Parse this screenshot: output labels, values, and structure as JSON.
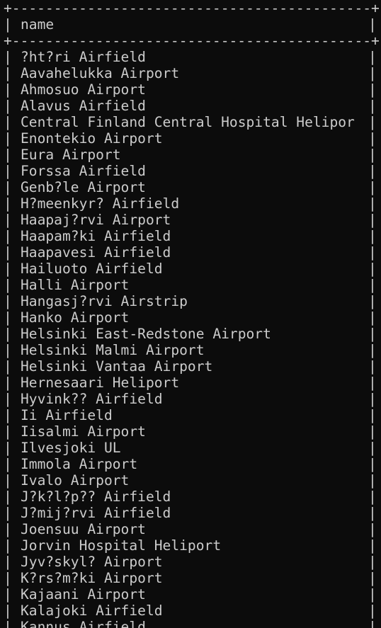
{
  "table": {
    "border_top": "+-------------------------------------------+",
    "header": "name",
    "border_mid": "+-------------------------------------------+",
    "pipe": "|",
    "rows": [
      "?ht?ri Airfield",
      "Aavahelukka Airport",
      "Ahmosuo Airport",
      "Alavus Airfield",
      "Central Finland Central Hospital Helipor",
      "Enontekio Airport",
      "Eura Airport",
      "Forssa Airfield",
      "Genb?le Airport",
      "H?meenkyr? Airfield",
      "Haapaj?rvi Airport",
      "Haapam?ki Airfield",
      "Haapavesi Airfield",
      "Hailuoto Airfield",
      "Halli Airport",
      "Hangasj?rvi Airstrip",
      "Hanko Airport",
      "Helsinki East-Redstone Airport",
      "Helsinki Malmi Airport",
      "Helsinki Vantaa Airport",
      "Hernesaari Heliport",
      "Hyvink?? Airfield",
      "Ii Airfield",
      "Iisalmi Airport",
      "Ilvesjoki UL",
      "Immola Airport",
      "Ivalo Airport",
      "J?k?l?p?? Airfield",
      "J?mij?rvi Airfield",
      "Joensuu Airport",
      "Jorvin Hospital Heliport",
      "Jyv?skyl? Airport",
      "K?rs?m?ki Airport",
      "Kajaani Airport",
      "Kalajoki Airfield",
      "Kannus Airfield"
    ]
  }
}
